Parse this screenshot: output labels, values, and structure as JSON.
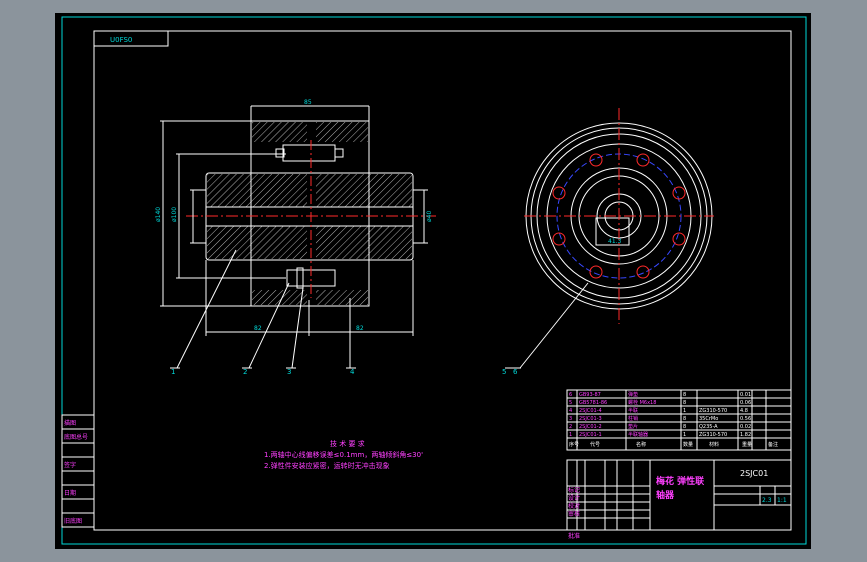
{
  "drawing": {
    "code_box": "U0FS0",
    "drawing_no": "2SJC01",
    "title_cn": "梅花 弹性联",
    "title_cn2": "轴器",
    "scale": "1:1",
    "sheet": "2.3"
  },
  "dimensions": {
    "top_width": "85",
    "dia_outer": "ø140",
    "dia_mid": "ø100",
    "dia_bore": "ø40",
    "len_left": "82",
    "len_right": "82",
    "keyway": "41.3"
  },
  "callouts": [
    "1",
    "2",
    "3",
    "4",
    "5",
    "6"
  ],
  "notes": {
    "heading": "技 术 要 求",
    "line1": "1.两轴中心线偏移误差≤0.1mm，两轴倾斜角≤30'",
    "line2": "2.弹性件安装应紧密，运转时无冲击现象"
  },
  "bom": [
    {
      "no": "6",
      "code": "GB93-87",
      "name": "弹垫",
      "qty": "8",
      "mat": "",
      "wt": "0.01"
    },
    {
      "no": "5",
      "code": "GB5781-86",
      "name": "螺栓 M6x18",
      "qty": "8",
      "mat": "",
      "wt": "0.06"
    },
    {
      "no": "4",
      "code": "2SJC01-4",
      "name": "半联",
      "qty": "1",
      "mat": "ZG310-570",
      "wt": "4.8"
    },
    {
      "no": "3",
      "code": "2SJC01-3",
      "name": "柱销",
      "qty": "8",
      "mat": "35CrMo",
      "wt": "0.56"
    },
    {
      "no": "2",
      "code": "2SJC01-2",
      "name": "垫片",
      "qty": "8",
      "mat": "Q235-A",
      "wt": "0.02"
    },
    {
      "no": "1",
      "code": "2SJC01-1",
      "name": "半联轴器",
      "qty": "1",
      "mat": "ZG310-570",
      "wt": "1.82"
    }
  ],
  "bom_header": [
    "序号",
    "代号",
    "名称",
    "数量",
    "材料",
    "重量",
    "备注"
  ],
  "title_block": {
    "row_labels": [
      "标记",
      "设计",
      "校对",
      "审核"
    ],
    "left_strip": [
      "描图",
      "底图总号",
      "签字",
      "日期",
      "旧底图"
    ],
    "bottom_label": "批准"
  }
}
